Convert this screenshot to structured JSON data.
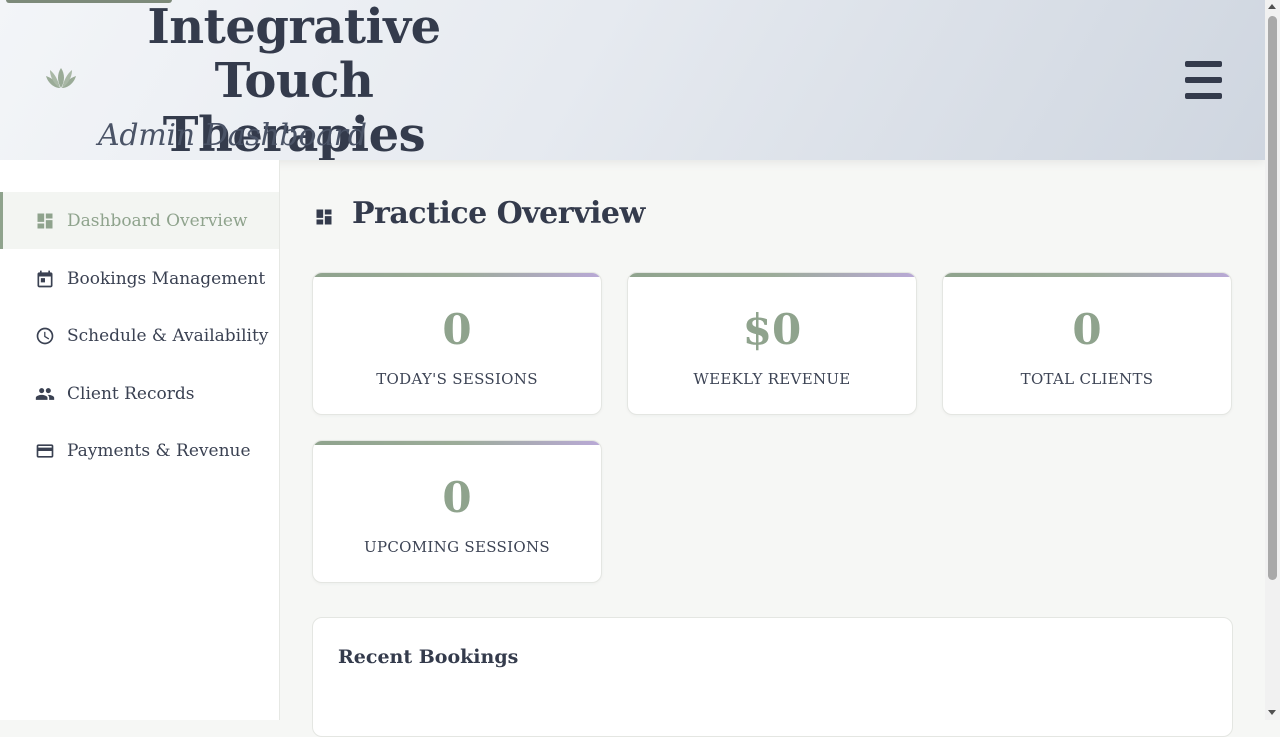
{
  "header": {
    "title": "Integrative Touch Therapies",
    "subtitle": "Admin Dashboard",
    "logo_icon": "lotus-icon",
    "menu_icon": "hamburger-menu-icon"
  },
  "sidebar": {
    "items": [
      {
        "label": "Dashboard Overview",
        "icon": "dashboard-icon",
        "active": true
      },
      {
        "label": "Bookings Management",
        "icon": "calendar-icon",
        "active": false
      },
      {
        "label": "Schedule & Availability",
        "icon": "clock-icon",
        "active": false
      },
      {
        "label": "Client Records",
        "icon": "people-icon",
        "active": false
      },
      {
        "label": "Payments & Revenue",
        "icon": "credit-card-icon",
        "active": false
      }
    ]
  },
  "main": {
    "title": "Practice Overview",
    "title_icon": "dashboard-icon",
    "stats": [
      {
        "value": "0",
        "label": "TODAY'S SESSIONS"
      },
      {
        "value": "$0",
        "label": "WEEKLY REVENUE"
      },
      {
        "value": "0",
        "label": "TOTAL CLIENTS"
      },
      {
        "value": "0",
        "label": "UPCOMING SESSIONS"
      }
    ],
    "recent_bookings": {
      "title": "Recent Bookings"
    }
  },
  "colors": {
    "accent": "#8fa38d",
    "accent_secondary": "#b9a9d6",
    "text": "#343b4c",
    "background": "#f6f7f5"
  }
}
